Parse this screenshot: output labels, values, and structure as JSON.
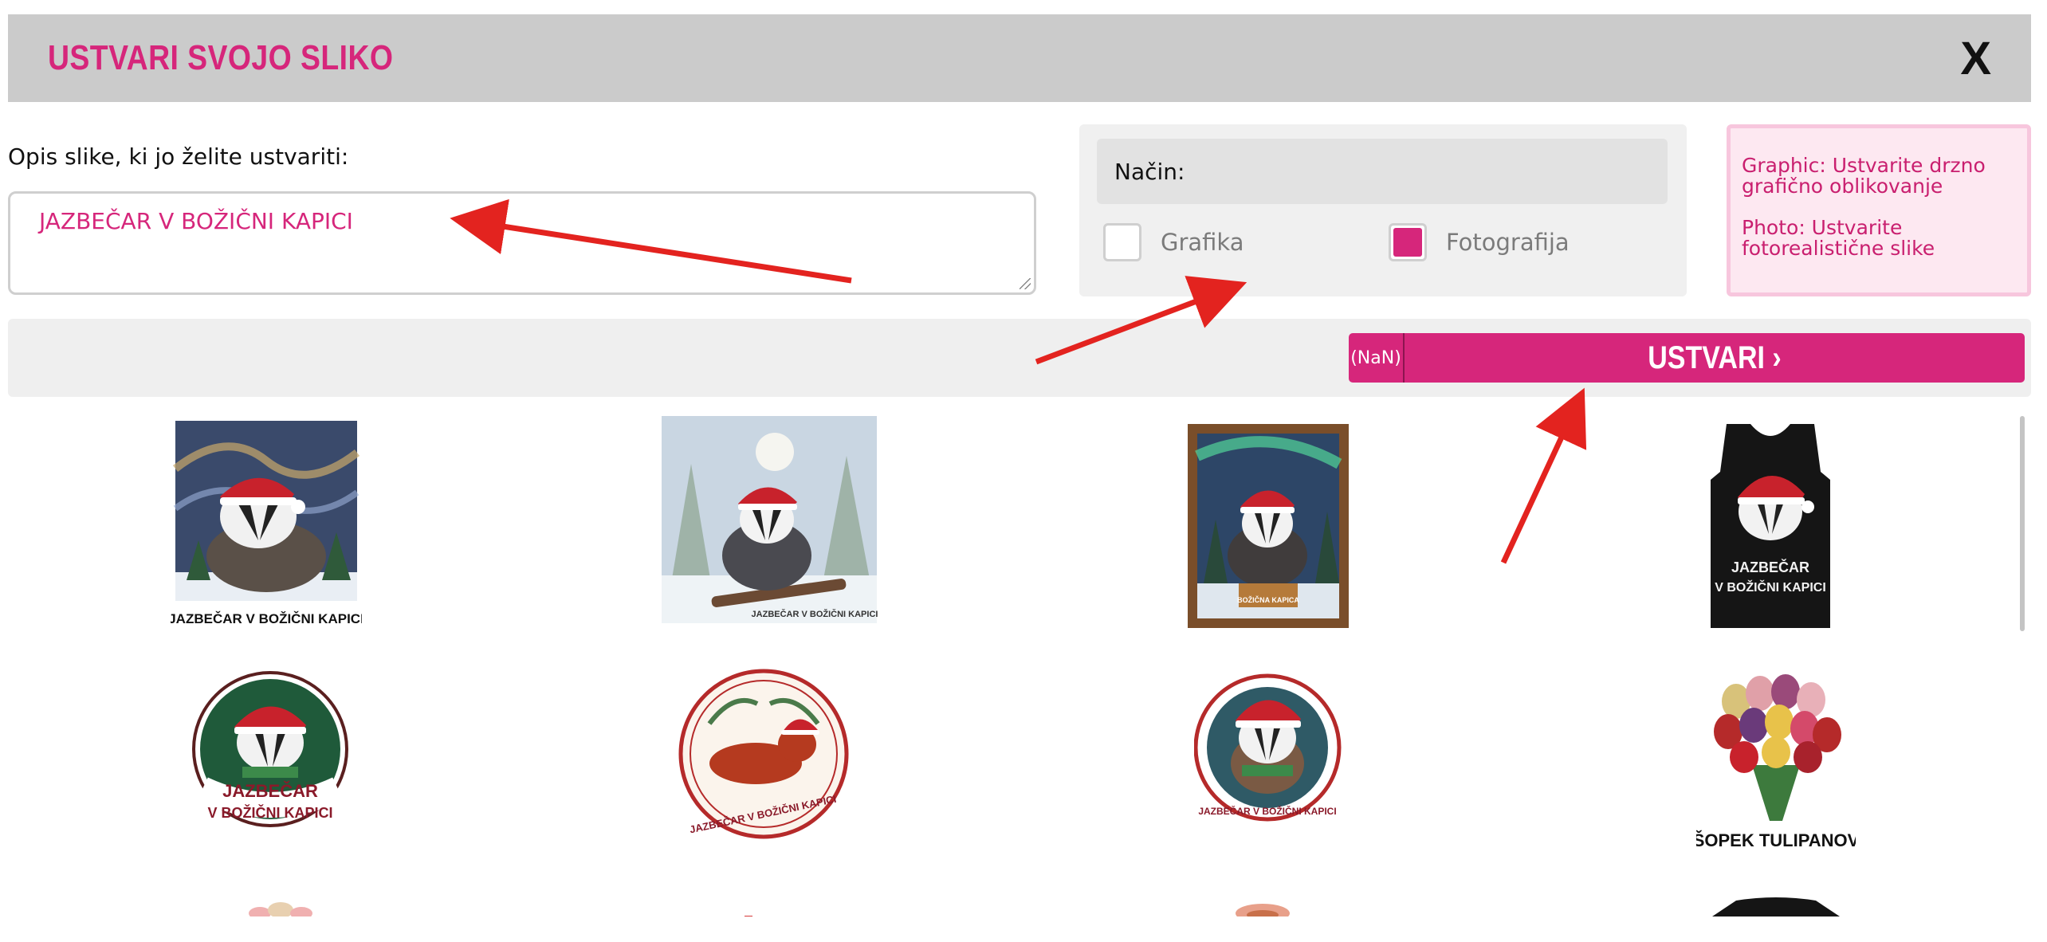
{
  "header": {
    "title": "USTVARI SVOJO SLIKO",
    "close_label": "X"
  },
  "description": {
    "label": "Opis slike, ki jo želite ustvariti:",
    "value": "JAZBEČAR V BOŽIČNI KAPICI"
  },
  "mode": {
    "label": "Način:",
    "options": [
      {
        "label": "Grafika",
        "checked": false
      },
      {
        "label": "Fotografija",
        "checked": true
      }
    ]
  },
  "info": {
    "graphic": "Graphic: Ustvarite drzno grafično oblikovanje",
    "photo": "Photo: Ustvarite fotorealistične slike"
  },
  "action": {
    "credits": "(NaN)",
    "button_label": "USTVARI",
    "button_icon": "chevron-right-icon"
  },
  "gallery": {
    "items": [
      {
        "caption": "JAZBEČAR V BOŽIČNI KAPICI",
        "kind": "badger-swirl-sky"
      },
      {
        "caption": "JAZBEČAR V BOŽIČNI KAPICI",
        "kind": "badger-snow-forest"
      },
      {
        "caption": "BOŽIČNA KAPICA",
        "kind": "badger-framed-aurora"
      },
      {
        "caption": "JAZBEČAR\nV BOŽIČNI KAPICI",
        "kind": "badger-tank-top"
      },
      {
        "caption": "JAZBEČAR\nV BOŽIČNI KAPICI",
        "kind": "badger-round-sticker"
      },
      {
        "caption": "JAZBEČAR V BOŽIČNI KAPICI",
        "kind": "dachshund-round-badge"
      },
      {
        "caption": "JAZBEČAR V BOŽIČNI KAPICI",
        "kind": "badger-round-badge"
      },
      {
        "caption": "ŠOPEK TULIPANOV",
        "kind": "tulip-bouquet"
      }
    ]
  },
  "colors": {
    "accent": "#d6267b",
    "header_bg": "#cbcbcb",
    "annotation_arrow": "#e3231f"
  }
}
